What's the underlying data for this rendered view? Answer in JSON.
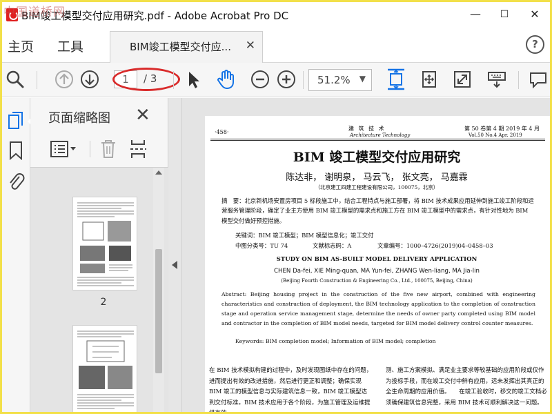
{
  "window": {
    "title": "BIM竣工模型交付应用研究.pdf - Adobe Acrobat Pro DC",
    "minimize": "—",
    "maximize": "☐",
    "close": "✕",
    "watermark": "中国道桥网"
  },
  "tabs": {
    "home": "主页",
    "tools": "工具",
    "document": "BIM竣工模型交付应...",
    "document_close": "✕",
    "help": "?"
  },
  "toolbar": {
    "page_current": "1",
    "page_total": "/ 3",
    "zoom": "51.2%",
    "zoom_arrow": "▼"
  },
  "panel": {
    "title": "页面缩略图",
    "close": "✕",
    "thumbnail_page_label": "2"
  },
  "document": {
    "page_no": "·458·",
    "journal_cn": "建 筑 技 术",
    "journal_en": "Architecture Technology",
    "issue_cn": "第 50 卷第 4 期  2019 年 4 月",
    "issue_en": "Vol.50 No.4   Apr. 2019",
    "title_cn": "BIM 竣工模型交付应用研究",
    "authors_cn": "陈达非，  谢明泉，  马云飞，  张文亮，  马嘉霖",
    "affiliation_cn": "（北京建工四建工程建设有限公司，100075，北京）",
    "abstract_cn": "摘　要：北京新机场安置房项目 5 标段施工中，结合工程特点与施工部署，将 BIM 技术成果应用延伸到施工竣工阶段和运营服务管理阶段，确定了业主方使用 BIM 竣工模型的需求点和施工方在 BIM 竣工模型中的需求点，有针对性地为 BIM 模型交付做好预控措施。",
    "keywords_cn": "关键词：BIM 竣工模型；BIM 模型信息化；竣工交付",
    "class_no": "中图分类号：TU 74",
    "doc_code": "文献标志码：A",
    "article_no": "文章编号：1000–4726(2019)04–0458–03",
    "title_en": "STUDY ON BIM AS-BUILT MODEL DELIVERY APPLICATION",
    "authors_en": "CHEN Da-fei, XIE Ming-quan, MA Yun-fei, ZHANG Wen-liang, MA Jia-lin",
    "affiliation_en": "(Beijing Fourth Construction & Engineering Co., Ltd., 100075, Beijing, China)",
    "abstract_en": "Abstract: Beijing housing project in the construction of the five new airport, combined with engineering characteristics and construction of deployment, the BIM technology application to the completion of construction stage and operation service management stage, determine the needs of owner party completed using BIM model and contractor in the completion of BIM model needs, targeted for BIM model delivery control counter measures.",
    "keywords_en": "Keywords: BIM completion model; Information of BIM model; completion",
    "body_col1": "在 BIM 技术模拟构建的过程中，及时发现图纸中存在的问题，进而提出有效的改进措施，然后进行更正和调整；确保实现 BIM 竣工的模型信息与实际建筑信息一致，BIM 竣工模型达到交付标准。BIM 技术应用于各个阶段，为施工管理及运维提供有效",
    "body_col2": "测、施工方案模拟、满足业主要求等较基础的应用阶段或仅作为投标手段，而在竣工交付中鲜有应用，远未发挥出其真正的全生命周期的应用价值。　　在竣工验收时，移交的竣工文档必须确保建筑信息完整，采用 BIM 技术可顺利解决这一问题。"
  },
  "colors": {
    "accent": "#1473e6",
    "annotation": "#d92b2b",
    "frame": "#f2e04a"
  }
}
